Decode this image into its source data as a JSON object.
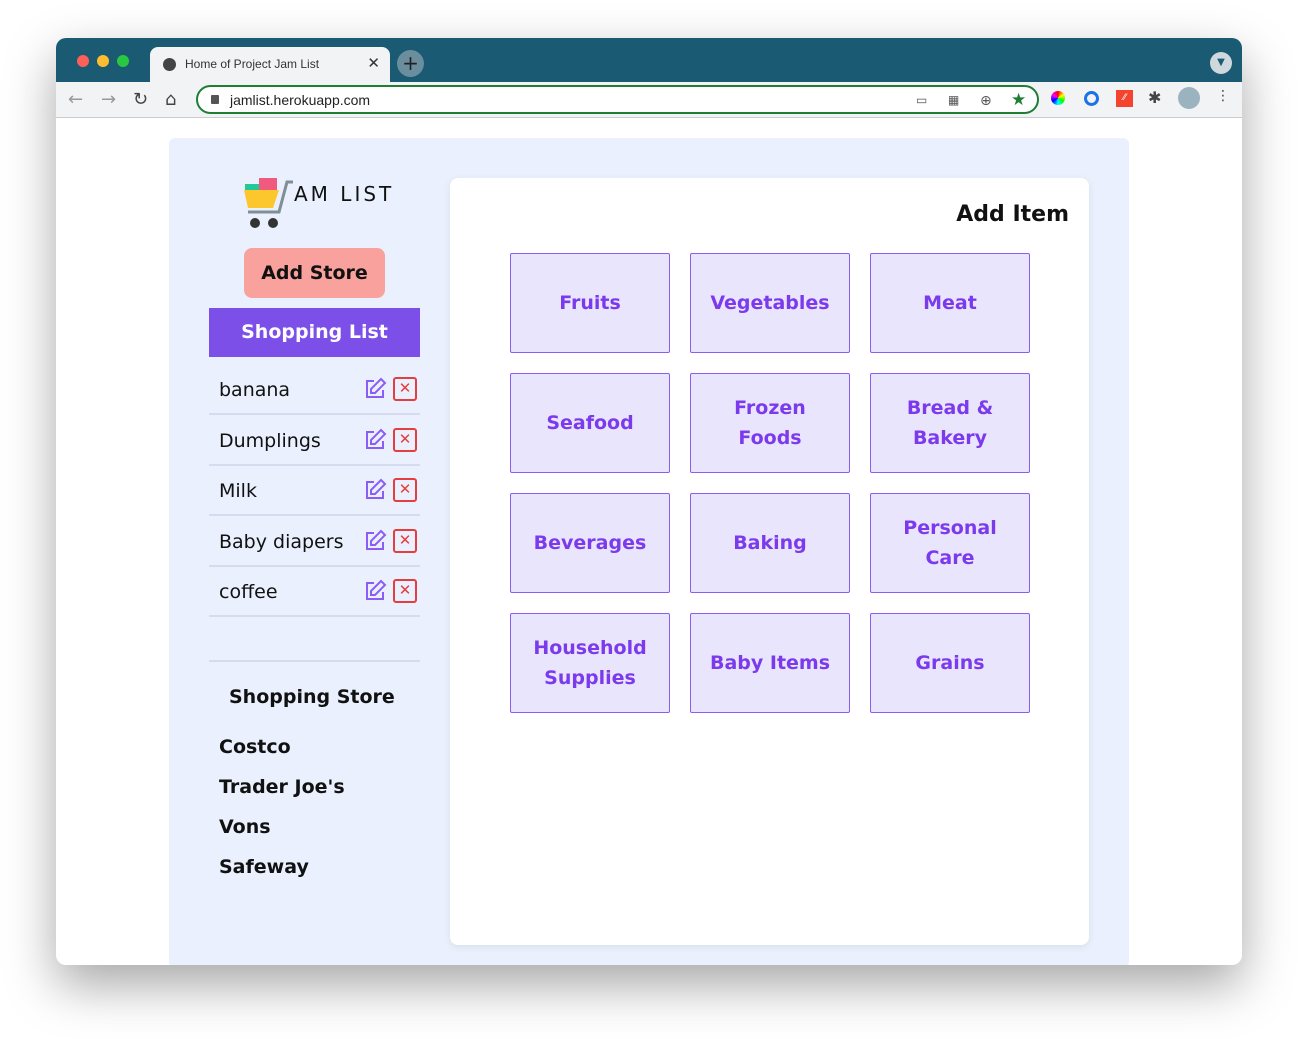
{
  "browser": {
    "tab_title": "Home of Project Jam List",
    "url": "jamlist.herokuapp.com"
  },
  "logo": {
    "text": "AM LIST"
  },
  "sidebar": {
    "add_store": "Add Store",
    "shopping_list": "Shopping List",
    "items": [
      {
        "name": "banana"
      },
      {
        "name": "Dumplings"
      },
      {
        "name": "Milk"
      },
      {
        "name": "Baby diapers"
      },
      {
        "name": "coffee"
      }
    ],
    "store_title": "Shopping Store",
    "stores": [
      "Costco",
      "Trader Joe's",
      "Vons",
      "Safeway"
    ]
  },
  "main": {
    "title": "Add Item",
    "categories": [
      "Fruits",
      "Vegetables",
      "Meat",
      "Seafood",
      "Frozen Foods",
      "Bread & Bakery",
      "Beverages",
      "Baking",
      "Personal Care",
      "Household Supplies",
      "Baby Items",
      "Grains"
    ]
  },
  "colors": {
    "accent": "#7c4fe9",
    "add_store": "#f9a19c",
    "delete": "#e53e3e",
    "tabbar": "#1a5a73"
  }
}
